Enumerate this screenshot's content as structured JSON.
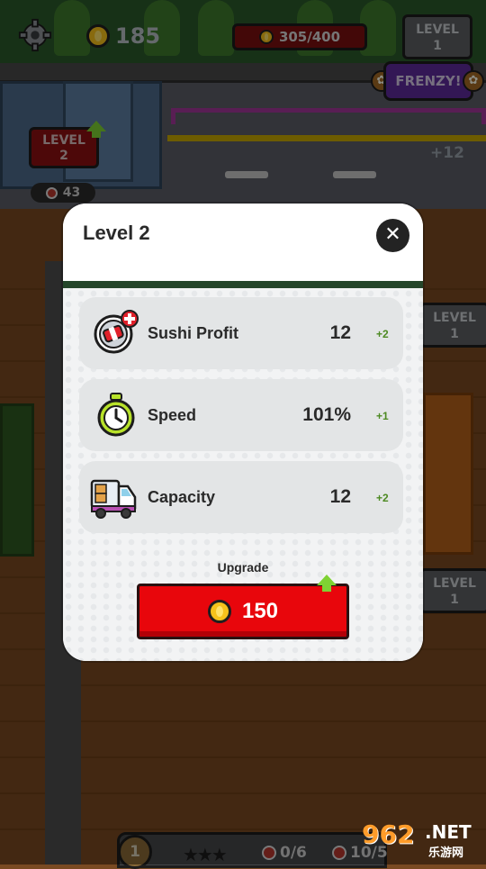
{
  "hud": {
    "coins": "185",
    "progress_text": "305/400",
    "level_top_line1": "LEVEL",
    "level_top_line2": "1",
    "frenzy_label": "FRENZY!"
  },
  "shop": {
    "level_line1": "LEVEL",
    "level_line2": "2",
    "sushi_count": "43",
    "truck_gain": "+12"
  },
  "side_levels": [
    {
      "line1": "LEVEL",
      "line2": "1"
    },
    {
      "line1": "LEVEL",
      "line2": "1"
    }
  ],
  "modal": {
    "title": "Level 2",
    "stats": [
      {
        "label": "Sushi Profit",
        "value": "12",
        "delta": "+2",
        "icon": "sushi-plus-icon"
      },
      {
        "label": "Speed",
        "value": "101%",
        "delta": "+1",
        "icon": "stopwatch-icon"
      },
      {
        "label": "Capacity",
        "value": "12",
        "delta": "+2",
        "icon": "delivery-truck-icon"
      }
    ],
    "upgrade_label": "Upgrade",
    "upgrade_cost": "150"
  },
  "bottom_bar": {
    "level_badge": "1",
    "stars": "★★★",
    "orders": "0/6",
    "sushi": "10/5"
  },
  "watermark": {
    "brand": "962",
    "net": ".NET",
    "cn": "乐游网"
  },
  "colors": {
    "upgrade_red": "#e8060c",
    "delta_green": "#4d8a22",
    "frenzy_purple": "#5e2a9c"
  }
}
